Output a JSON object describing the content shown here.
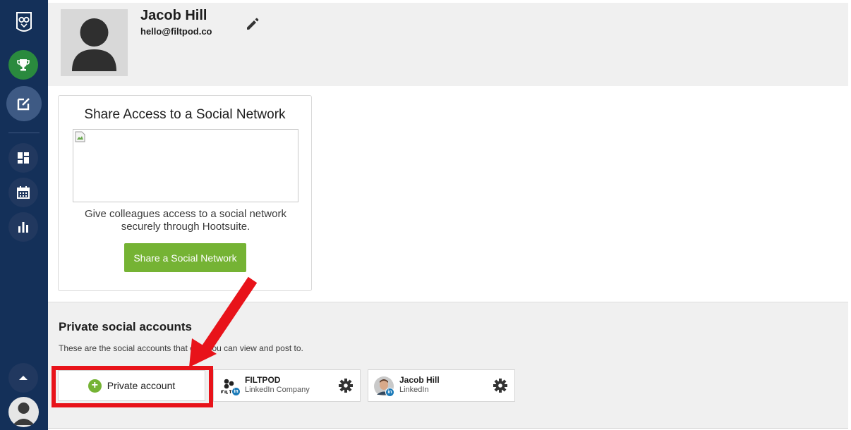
{
  "sidebar": {
    "items": [
      {
        "name": "trophy-icon"
      },
      {
        "name": "compose-icon"
      },
      {
        "name": "dashboard-icon"
      },
      {
        "name": "calendar-icon"
      },
      {
        "name": "analytics-icon"
      },
      {
        "name": "chevron-up-icon"
      }
    ]
  },
  "profile": {
    "name": "Jacob Hill",
    "email": "hello@filtpod.co"
  },
  "share_card": {
    "title": "Share Access to a Social Network",
    "description": "Give colleagues access to a social network securely through Hootsuite.",
    "button_label": "Share a Social Network"
  },
  "private_section": {
    "title": "Private social accounts",
    "description": "These are the social accounts that only you can view and post to.",
    "add_button_label": "Private account"
  },
  "accounts": [
    {
      "name": "FILTPOD",
      "type": "LinkedIn Company"
    },
    {
      "name": "Jacob Hill",
      "type": "LinkedIn"
    }
  ],
  "colors": {
    "sidebar": "#143059",
    "green": "#75b334",
    "highlight": "#e8131a"
  }
}
